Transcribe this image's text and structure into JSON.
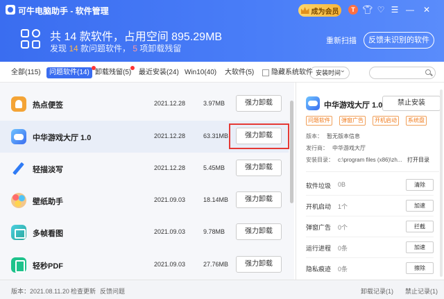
{
  "window": {
    "title": "可牛电脑助手 - 软件管理",
    "vip_label": "成为会员",
    "avatar_letter": "T"
  },
  "summary": {
    "line1": "共 14 款软件，占用空间 895.29MB",
    "line2_prefix": "发现 ",
    "problem_count": "14",
    "line2_mid": " 款问题软件， ",
    "residue_count": "5",
    "line2_suffix": " 项卸载残留",
    "rescan_label": "重新扫描",
    "feedback_label": "反馈未识别的软件"
  },
  "tabs": [
    {
      "label": "全部(115)"
    },
    {
      "label": "问题软件(14)"
    },
    {
      "label": "卸载残留(5)"
    },
    {
      "label": "最近安装(24)"
    },
    {
      "label": "Win10(40)"
    },
    {
      "label": "大软件(5)"
    }
  ],
  "filters": {
    "hide_system_label": "隐藏系统软件",
    "sort_label": "安装时间"
  },
  "list": {
    "uninstall_label": "强力卸载",
    "rows": [
      {
        "name": "热点便签",
        "date": "2021.12.28",
        "size": "3.97MB"
      },
      {
        "name": "中华游戏大厅 1.0",
        "date": "2021.12.28",
        "size": "63.31MB"
      },
      {
        "name": "轻描淡写",
        "date": "2021.12.28",
        "size": "5.45MB"
      },
      {
        "name": "壁纸助手",
        "date": "2021.09.03",
        "size": "18.14MB"
      },
      {
        "name": "多帧看图",
        "date": "2021.09.03",
        "size": "9.78MB"
      },
      {
        "name": "轻秒PDF",
        "date": "2021.09.03",
        "size": "27.76MB"
      }
    ]
  },
  "detail": {
    "name": "中华游戏大厅 1.0",
    "forbid_label": "禁止安装",
    "tags": [
      "问题软件",
      "弹窗广告",
      "开机启动",
      "系统盘"
    ],
    "version_label": "版本：",
    "version_value": "暂无版本信息",
    "publisher_label": "发行商：",
    "publisher_value": "中华游戏大厅",
    "install_dir_label": "安装目录：",
    "install_dir_value": "c:\\program files (x86)\\zh...",
    "open_dir_label": "打开目录",
    "stats": [
      {
        "label": "软件垃圾",
        "value": "0B",
        "action": "清除"
      },
      {
        "label": "开机启动",
        "value": "1个",
        "action": "加速"
      },
      {
        "label": "弹窗广告",
        "value": "0个",
        "action": "拦截"
      },
      {
        "label": "运行进程",
        "value": "0条",
        "action": "加速"
      },
      {
        "label": "隐私痕迹",
        "value": "0条",
        "action": "擦除"
      }
    ]
  },
  "footer": {
    "version": "版本：2021.08.11.20",
    "check_update": "检查更新",
    "feedback": "反馈问题",
    "uninstall_log": "卸载记录(1)",
    "forbid_log": "禁止记录(1)"
  }
}
